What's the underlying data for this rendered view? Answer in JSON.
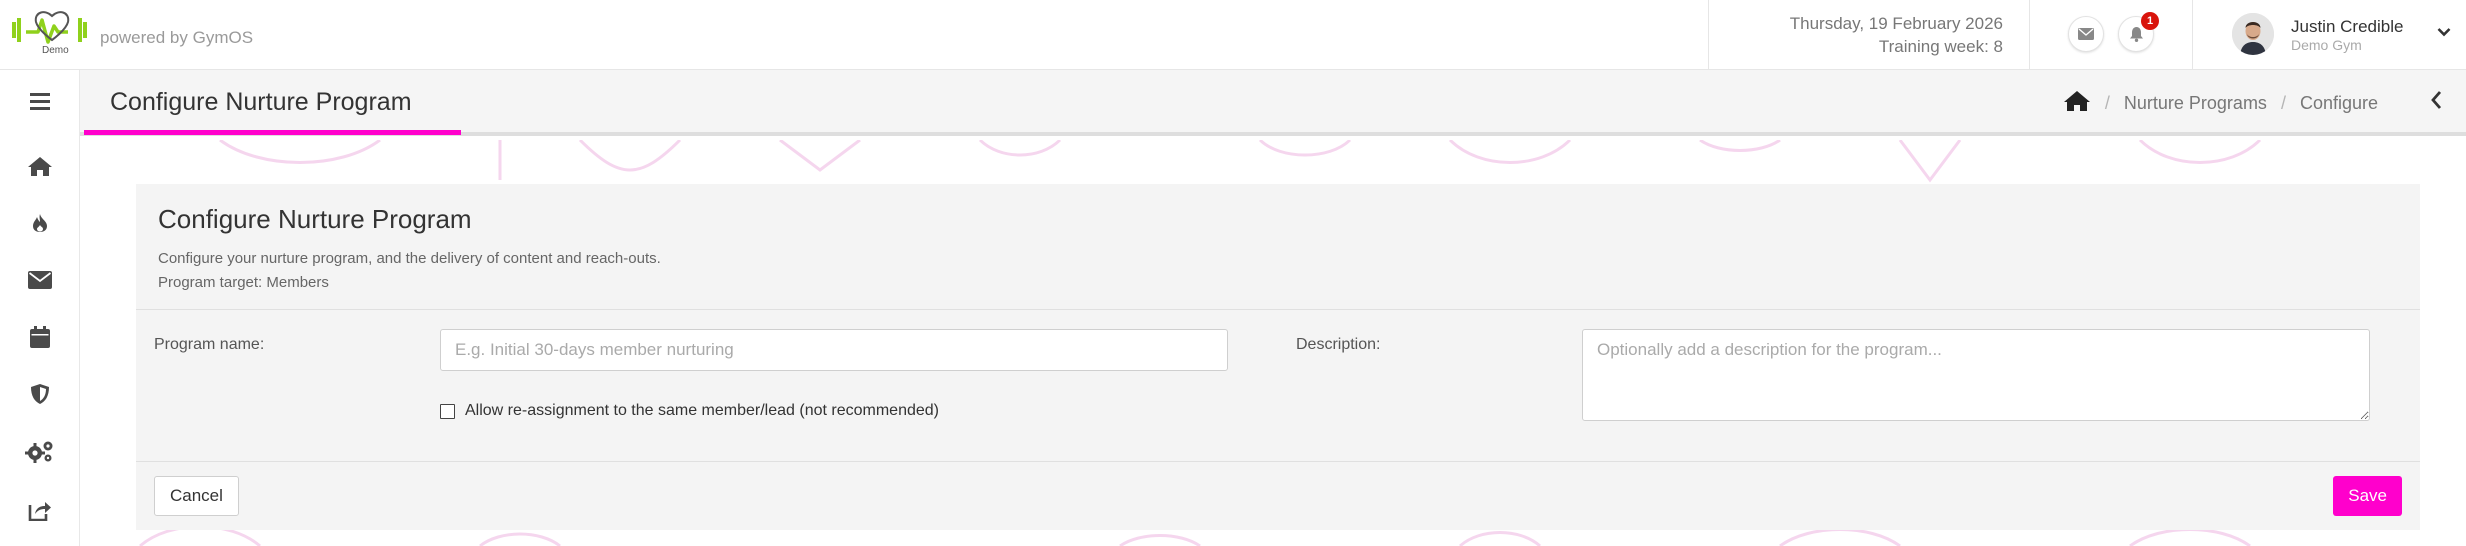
{
  "header": {
    "logo_text": "Demo",
    "powered_by": "powered by GymOS",
    "date": "Thursday, 19 February 2026",
    "training_week": "Training week: 8",
    "notification_count": "1",
    "user_name": "Justin Credible",
    "user_gym": "Demo Gym"
  },
  "sidebar": {
    "items": [
      {
        "icon": "menu-icon"
      },
      {
        "icon": "home-icon"
      },
      {
        "icon": "fire-icon"
      },
      {
        "icon": "envelope-icon"
      },
      {
        "icon": "calendar-icon"
      },
      {
        "icon": "shield-icon"
      },
      {
        "icon": "gears-icon"
      },
      {
        "icon": "share-icon"
      }
    ]
  },
  "page": {
    "title": "Configure Nurture Program",
    "breadcrumbs": [
      "Nurture Programs",
      "Configure"
    ]
  },
  "form": {
    "title": "Configure Nurture Program",
    "subtitle": "Configure your nurture program, and the delivery of content and reach-outs.",
    "target": "Program target: Members",
    "name_label": "Program name:",
    "name_placeholder": "E.g. Initial 30-days member nurturing",
    "name_value": "",
    "description_label": "Description:",
    "description_placeholder": "Optionally add a description for the program...",
    "description_value": "",
    "reassign_label": "Allow re-assignment to the same member/lead (not recommended)",
    "reassign_checked": false,
    "cancel_label": "Cancel",
    "save_label": "Save"
  },
  "colors": {
    "accent": "#ff00cc",
    "badge": "#d9140c",
    "icon": "#4a4a4a",
    "logo_green": "#8fd11c"
  }
}
